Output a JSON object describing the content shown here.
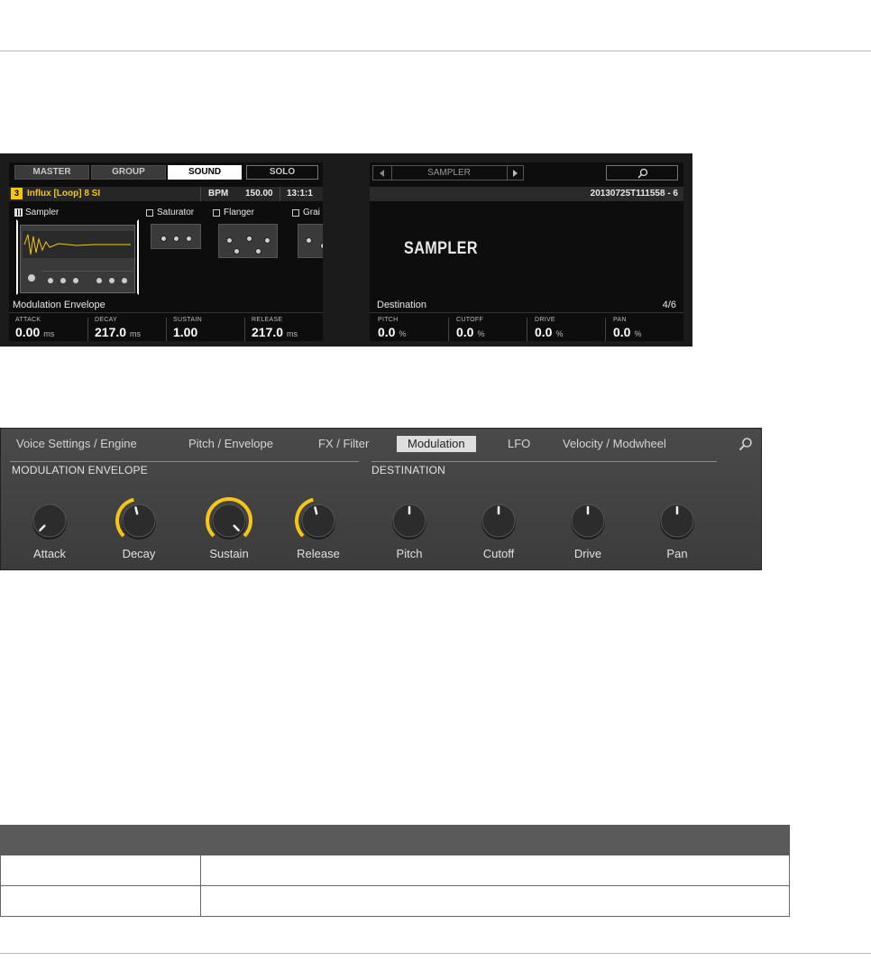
{
  "hardware": {
    "tabs": [
      "MASTER",
      "GROUP",
      "SOUND",
      "SOLO"
    ],
    "active_tab": "SOUND",
    "slot_number": "3",
    "sound_name": "Influx [Loop] 8 SI",
    "bpm_label": "BPM",
    "bpm_value": "150.00",
    "position": "13:1:1",
    "plugins": [
      "Sampler",
      "Saturator",
      "Flanger",
      "Grai"
    ],
    "left_page_title": "Modulation Envelope",
    "left_params": [
      {
        "label": "ATTACK",
        "value": "0.00",
        "unit": "ms"
      },
      {
        "label": "DECAY",
        "value": "217.0",
        "unit": "ms"
      },
      {
        "label": "SUSTAIN",
        "value": "1.00",
        "unit": ""
      },
      {
        "label": "RELEASE",
        "value": "217.0",
        "unit": "ms"
      }
    ],
    "browser_title": "SAMPLER",
    "sample_name": "20130725T111558 - 6",
    "big_label": "SAMPLER",
    "right_page_title": "Destination",
    "page_indicator": "4/6",
    "right_params": [
      {
        "label": "PITCH",
        "value": "0.0",
        "unit": "%"
      },
      {
        "label": "CUTOFF",
        "value": "0.0",
        "unit": "%"
      },
      {
        "label": "DRIVE",
        "value": "0.0",
        "unit": "%"
      },
      {
        "label": "PAN",
        "value": "0.0",
        "unit": "%"
      }
    ]
  },
  "software": {
    "tabs": [
      "Voice Settings / Engine",
      "Pitch / Envelope",
      "FX / Filter",
      "Modulation",
      "LFO",
      "Velocity / Modwheel"
    ],
    "active_tab": "Modulation",
    "sections": [
      "MODULATION ENVELOPE",
      "DESTINATION"
    ],
    "knobs": [
      {
        "label": "Attack",
        "level": 0.0
      },
      {
        "label": "Decay",
        "level": 0.45
      },
      {
        "label": "Sustain",
        "level": 1.0
      },
      {
        "label": "Release",
        "level": 0.45
      },
      {
        "label": "Pitch",
        "level": 0.5
      },
      {
        "label": "Cutoff",
        "level": 0.5
      },
      {
        "label": "Drive",
        "level": 0.5
      },
      {
        "label": "Pan",
        "level": 0.5
      }
    ],
    "accent_color": "#f5c518"
  },
  "table": {
    "columns": [
      "",
      ""
    ],
    "rows": [
      [
        "",
        ""
      ],
      [
        "",
        ""
      ]
    ]
  }
}
